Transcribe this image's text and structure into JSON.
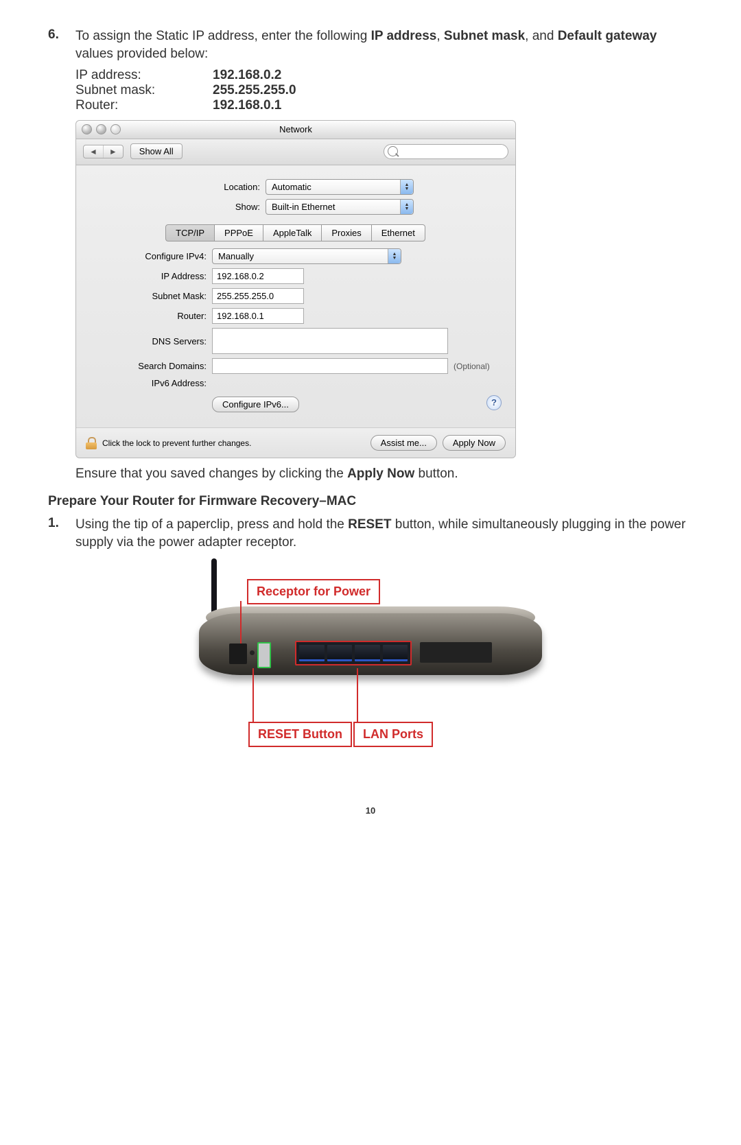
{
  "step6": {
    "num": "6.",
    "text_pre": "To assign the Static IP address, enter the following ",
    "b1": "IP address",
    "sep1": ", ",
    "b2": "Subnet mask",
    "sep2": ", and ",
    "b3": "Default gateway",
    "text_post": " values provided below:"
  },
  "ipvals": {
    "ip_label": "IP address:",
    "ip_val": "192.168.0.2",
    "mask_label": "Subnet mask:",
    "mask_val": "255.255.255.0",
    "router_label": "Router:",
    "router_val": "192.168.0.1"
  },
  "mac": {
    "title": "Network",
    "showall": "Show All",
    "search_placeholder": "",
    "location_label": "Location:",
    "location_value": "Automatic",
    "show_label": "Show:",
    "show_value": "Built-in Ethernet",
    "tabs": [
      "TCP/IP",
      "PPPoE",
      "AppleTalk",
      "Proxies",
      "Ethernet"
    ],
    "active_tab": 0,
    "configure_label": "Configure IPv4:",
    "configure_value": "Manually",
    "ip_label": "IP Address:",
    "ip_value": "192.168.0.2",
    "mask_label": "Subnet Mask:",
    "mask_value": "255.255.255.0",
    "router_label": "Router:",
    "router_value": "192.168.0.1",
    "dns_label": "DNS Servers:",
    "dns_value": "",
    "search_label": "Search Domains:",
    "search_value": "",
    "optional": "(Optional)",
    "ipv6addr_label": "IPv6 Address:",
    "conf6_btn": "Configure IPv6...",
    "help": "?",
    "lock_text": "Click the lock to prevent further changes.",
    "assist_btn": "Assist me...",
    "apply_btn": "Apply Now"
  },
  "apply_note_pre": "Ensure that you saved changes by clicking the ",
  "apply_note_b": "Apply Now",
  "apply_note_post": " button.",
  "section_head": "Prepare Your Router for Firmware Recovery–MAC",
  "step1": {
    "num": "1.",
    "pre": "Using the tip of a paperclip, press and hold the ",
    "b1": "RESET",
    "mid": " button, while simultaneously plugging in the power supply via the power adapter receptor."
  },
  "router_labels": {
    "power": "Receptor for Power",
    "reset": "RESET Button",
    "lan": "LAN Ports"
  },
  "page_num": "10"
}
